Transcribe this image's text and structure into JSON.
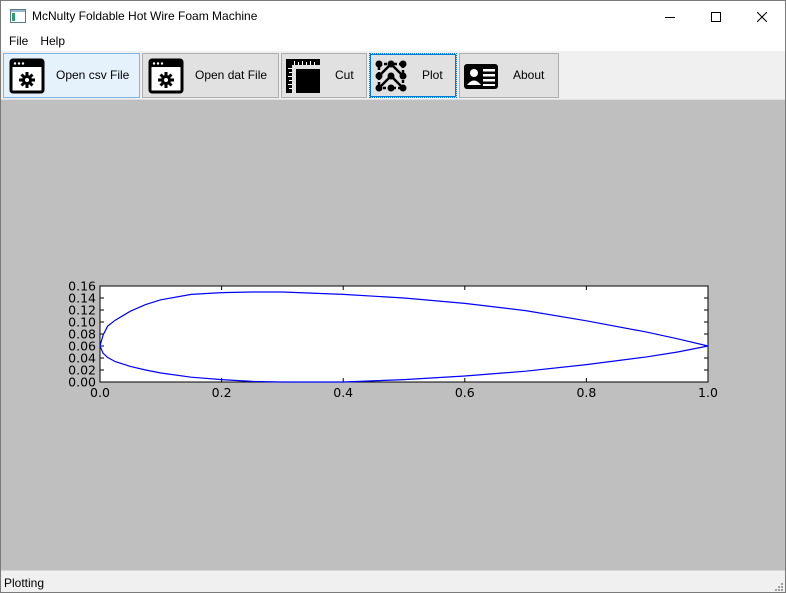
{
  "window": {
    "title": "McNulty Foldable Hot Wire Foam Machine",
    "icon": "app-window-icon",
    "controls": [
      "minimize-icon",
      "maximize-icon",
      "close-icon"
    ]
  },
  "menu": {
    "items": [
      {
        "label": "File"
      },
      {
        "label": "Help"
      }
    ]
  },
  "toolbar": {
    "buttons": [
      {
        "label": "Open csv File",
        "icon": "gear-window-icon"
      },
      {
        "label": "Open dat File",
        "icon": "gear-window-icon"
      },
      {
        "label": "Cut",
        "icon": "ruler-square-icon"
      },
      {
        "label": "Plot",
        "icon": "node-graph-icon"
      },
      {
        "label": "About",
        "icon": "id-card-icon"
      }
    ]
  },
  "status": {
    "text": "Plotting"
  },
  "colors": {
    "plot_line": "#0000ff",
    "central_background": "#bfbfbf",
    "toolbar_background": "#f0f0f0",
    "button_background": "#e1e1e1",
    "active_button_background": "#e5f1fb",
    "focus_border": "#0078d7"
  },
  "chart_data": {
    "type": "line",
    "xlim": [
      0.0,
      1.0
    ],
    "ylim": [
      0.0,
      0.16
    ],
    "x_ticks": [
      "0.0",
      "0.2",
      "0.4",
      "0.6",
      "0.8",
      "1.0"
    ],
    "y_ticks": [
      "0.00",
      "0.02",
      "0.04",
      "0.06",
      "0.08",
      "0.10",
      "0.12",
      "0.14",
      "0.16"
    ],
    "grid": false,
    "series": [
      {
        "x": [
          1.0,
          0.95,
          0.9,
          0.8,
          0.7,
          0.6,
          0.5,
          0.4,
          0.3,
          0.25,
          0.2,
          0.15,
          0.1,
          0.075,
          0.05,
          0.025,
          0.0125,
          0.005,
          0.0,
          0.005,
          0.0125,
          0.025,
          0.05,
          0.075,
          0.1,
          0.15,
          0.2,
          0.25,
          0.3,
          0.4,
          0.5,
          0.6,
          0.7,
          0.8,
          0.9,
          0.95,
          1.0
        ],
        "y": [
          0.06,
          0.072,
          0.083,
          0.102,
          0.119,
          0.131,
          0.14,
          0.146,
          0.15,
          0.15,
          0.149,
          0.146,
          0.137,
          0.129,
          0.118,
          0.103,
          0.093,
          0.078,
          0.06,
          0.048,
          0.041,
          0.034,
          0.026,
          0.02,
          0.015,
          0.008,
          0.004,
          0.001,
          0.0,
          0.0,
          0.004,
          0.01,
          0.018,
          0.029,
          0.042,
          0.05,
          0.06
        ]
      }
    ]
  }
}
